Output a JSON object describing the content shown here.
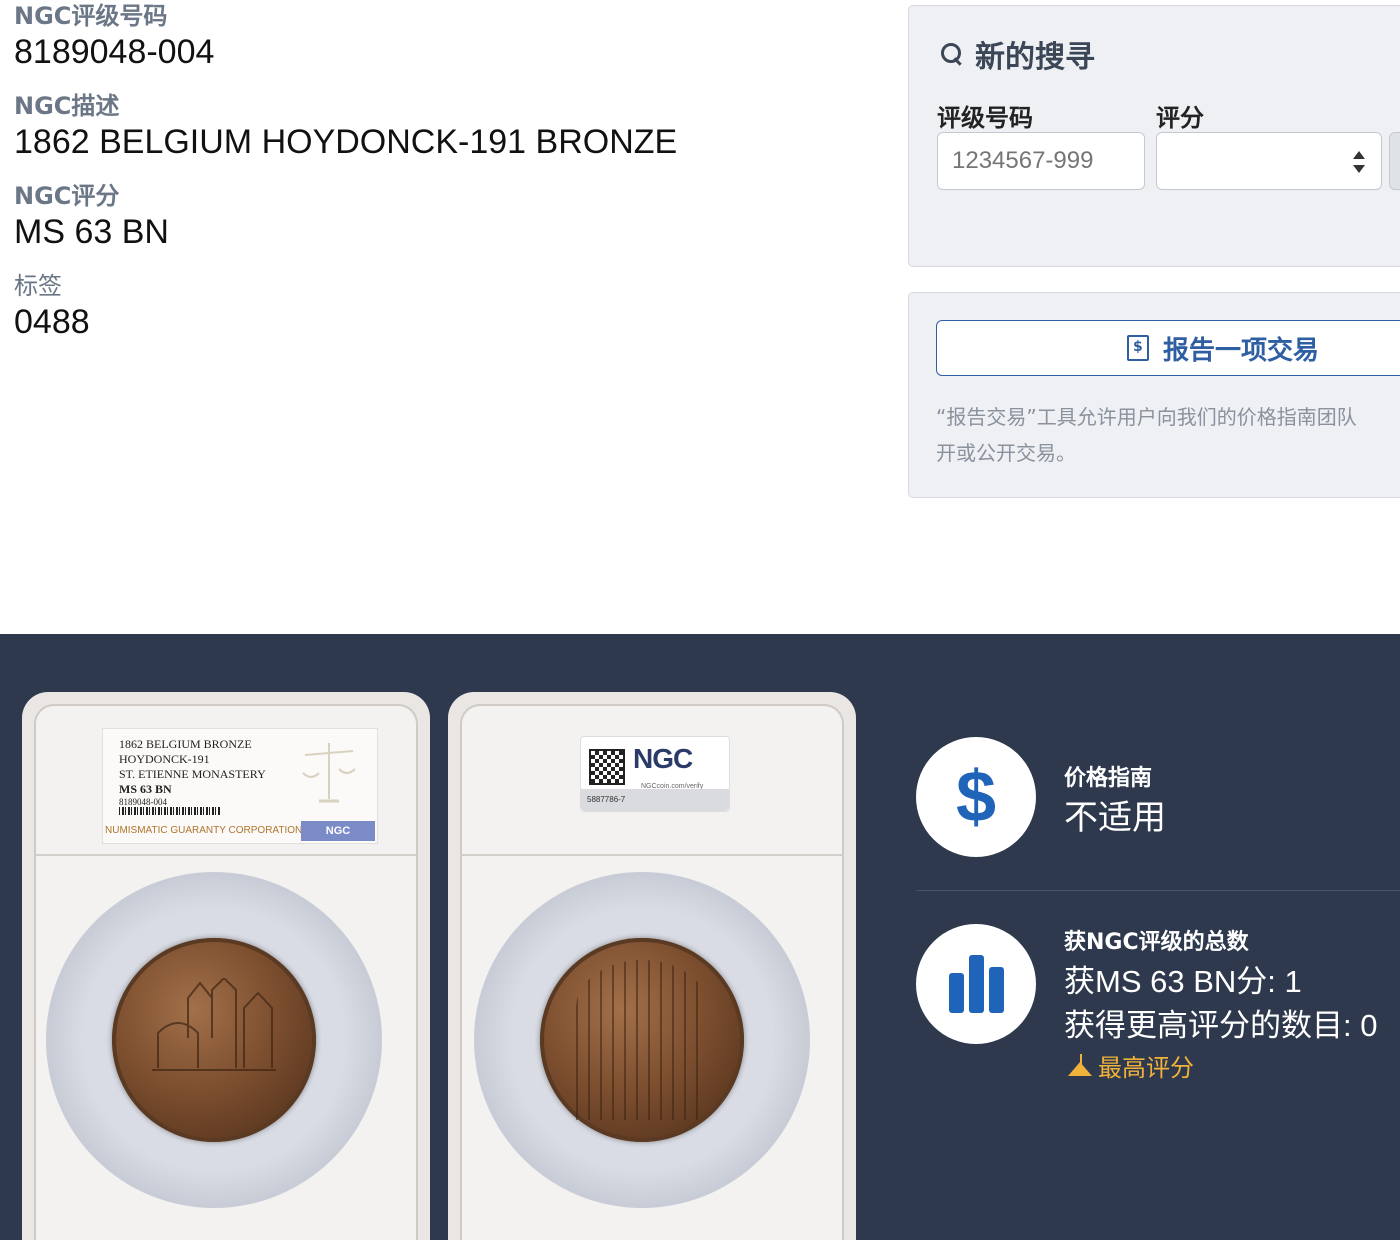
{
  "cert": {
    "number_label": "NGC评级号码",
    "number_value": "8189048-004",
    "description_label": "NGC描述",
    "description_value": "1862 BELGIUM HOYDONCK-191 BRONZE",
    "grade_label": "NGC评分",
    "grade_value": "MS 63 BN",
    "label_label": "标签",
    "label_value": "0488"
  },
  "search": {
    "title": "新的搜寻",
    "cert_label": "评级号码",
    "grade_label": "评分",
    "cert_placeholder": "1234567-999",
    "grade_value": ""
  },
  "report": {
    "button_label": "报告一项交易",
    "description_line1": "“报告交易”工具允许用户向我们的价格指南团队",
    "description_line2": "开或公开交易。"
  },
  "slab_front": {
    "line1": "1862 BELGIUM BRONZE",
    "line2": "HOYDONCK-191",
    "line3": "ST. ETIENNE MONASTERY",
    "line4": "MS 63 BN",
    "line5": "8189048-004",
    "footer": "NUMISMATIC GUARANTY CORPORATION",
    "logo": "NGC"
  },
  "slab_back": {
    "logo": "NGC",
    "tagline": "NGCcoin.com/verify",
    "serial": "5887786-7"
  },
  "price_guide": {
    "title": "价格指南",
    "value": "不适用",
    "icon": "dollar-icon"
  },
  "population": {
    "title": "获NGC评级的总数",
    "at_grade": "获MS 63 BN分: 1",
    "higher": "获得更高评分的数目: 0",
    "top_pop_label": "最高评分",
    "icon": "bar-chart-icon"
  },
  "colors": {
    "accent_blue": "#1f64b8",
    "report_blue": "#2f5fa3",
    "dark_band": "#2e394d",
    "top_pop_gold": "#f0b23a"
  }
}
